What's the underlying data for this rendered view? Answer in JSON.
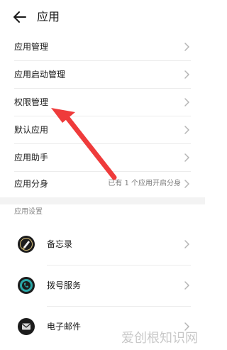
{
  "header": {
    "title": "应用",
    "back_icon": "arrow-left-icon"
  },
  "menu": [
    {
      "label": "应用管理",
      "sub": ""
    },
    {
      "label": "应用启动管理",
      "sub": ""
    },
    {
      "label": "权限管理",
      "sub": ""
    },
    {
      "label": "默认应用",
      "sub": ""
    },
    {
      "label": "应用助手",
      "sub": ""
    },
    {
      "label": "应用分身",
      "sub": "已有 1 个应用开启分身"
    }
  ],
  "section": {
    "title": "应用设置"
  },
  "apps": [
    {
      "label": "备忘录",
      "icon": "notes-icon"
    },
    {
      "label": "拨号服务",
      "icon": "phone-icon"
    },
    {
      "label": "电子邮件",
      "icon": "mail-icon"
    }
  ],
  "watermark": "爱创根知识网",
  "colors": {
    "arrow": "#ef3b3b",
    "chevron": "#b5b5b5",
    "icon_bg": "#1c1c1c"
  }
}
